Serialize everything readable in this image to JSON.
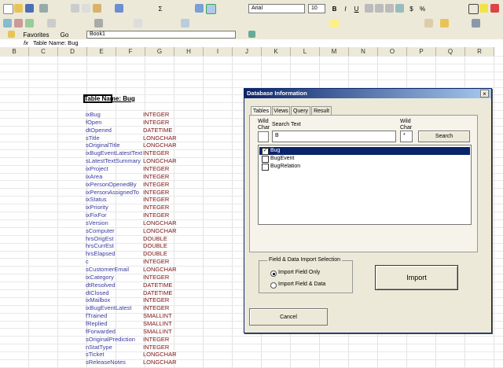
{
  "toolbar": {
    "font_name": "Arial",
    "font_size": "10",
    "favorites_label": "Favorites",
    "go_label": "Go",
    "address": "Book1",
    "bold": "B",
    "italic": "I",
    "underline": "U",
    "sigma": "Σ",
    "percent": "%"
  },
  "formula_bar": {
    "fx": "fx",
    "content": "Table Name: Bug"
  },
  "columns": [
    "B",
    "C",
    "D",
    "E",
    "F",
    "G",
    "H",
    "I",
    "J",
    "K",
    "L",
    "M",
    "N",
    "O",
    "P",
    "Q",
    "R"
  ],
  "sheet": {
    "header": "Table Name: Bug",
    "fields": [
      {
        "name": "ixBug",
        "type": "INTEGER"
      },
      {
        "name": "fOpen",
        "type": "INTEGER"
      },
      {
        "name": "dtOpened",
        "type": "DATETIME"
      },
      {
        "name": "sTitle",
        "type": "LONGCHAR"
      },
      {
        "name": "sOriginalTitle",
        "type": "LONGCHAR"
      },
      {
        "name": "ixBugEventLatestText",
        "type": "INTEGER"
      },
      {
        "name": "sLatestTextSummary",
        "type": "LONGCHAR"
      },
      {
        "name": "ixProject",
        "type": "INTEGER"
      },
      {
        "name": "ixArea",
        "type": "INTEGER"
      },
      {
        "name": "ixPersonOpenedBy",
        "type": "INTEGER"
      },
      {
        "name": "ixPersonAssignedTo",
        "type": "INTEGER"
      },
      {
        "name": "ixStatus",
        "type": "INTEGER"
      },
      {
        "name": "ixPriority",
        "type": "INTEGER"
      },
      {
        "name": "ixFixFor",
        "type": "INTEGER"
      },
      {
        "name": "sVersion",
        "type": "LONGCHAR"
      },
      {
        "name": "sComputer",
        "type": "LONGCHAR"
      },
      {
        "name": "hrsOrigEst",
        "type": "DOUBLE"
      },
      {
        "name": "hrsCurrEst",
        "type": "DOUBLE"
      },
      {
        "name": "hrsElapsed",
        "type": "DOUBLE"
      },
      {
        "name": "c",
        "type": "INTEGER"
      },
      {
        "name": "sCustomerEmail",
        "type": "LONGCHAR"
      },
      {
        "name": "ixCategory",
        "type": "INTEGER"
      },
      {
        "name": "dtResolved",
        "type": "DATETIME"
      },
      {
        "name": "dtClosed",
        "type": "DATETIME"
      },
      {
        "name": "ixMailbox",
        "type": "INTEGER"
      },
      {
        "name": "ixBugEventLatest",
        "type": "INTEGER"
      },
      {
        "name": "fTrained",
        "type": "SMALLINT"
      },
      {
        "name": "fReplied",
        "type": "SMALLINT"
      },
      {
        "name": "fForwarded",
        "type": "SMALLINT"
      },
      {
        "name": "sOriginalPrediction",
        "type": "INTEGER"
      },
      {
        "name": "nStatType",
        "type": "INTEGER"
      },
      {
        "name": "sTicket",
        "type": "LONGCHAR"
      },
      {
        "name": "sReleaseNotes",
        "type": "LONGCHAR"
      }
    ]
  },
  "dialog": {
    "title": "Database Information",
    "close": "×",
    "tabs": [
      "Tables",
      "Views",
      "Query",
      "Result"
    ],
    "wild_char_left": "Wild Char",
    "search_text_label": "Search Text",
    "search_value": "B",
    "wild_char_right": "Wild Char",
    "wild_char_right_value": "*",
    "search_button": "Search",
    "tables": [
      {
        "name": "Bug",
        "checked": true,
        "selected": true
      },
      {
        "name": "BugEvent",
        "checked": false,
        "selected": false
      },
      {
        "name": "BugRelation",
        "checked": false,
        "selected": false
      }
    ],
    "import_group_label": "Field & Data Import Selection",
    "radio_field_only": "Import Field Only",
    "radio_field_data": "Import Field & Data",
    "import_button": "Import",
    "cancel_button": "Cancel",
    "check_mark": "✓"
  }
}
